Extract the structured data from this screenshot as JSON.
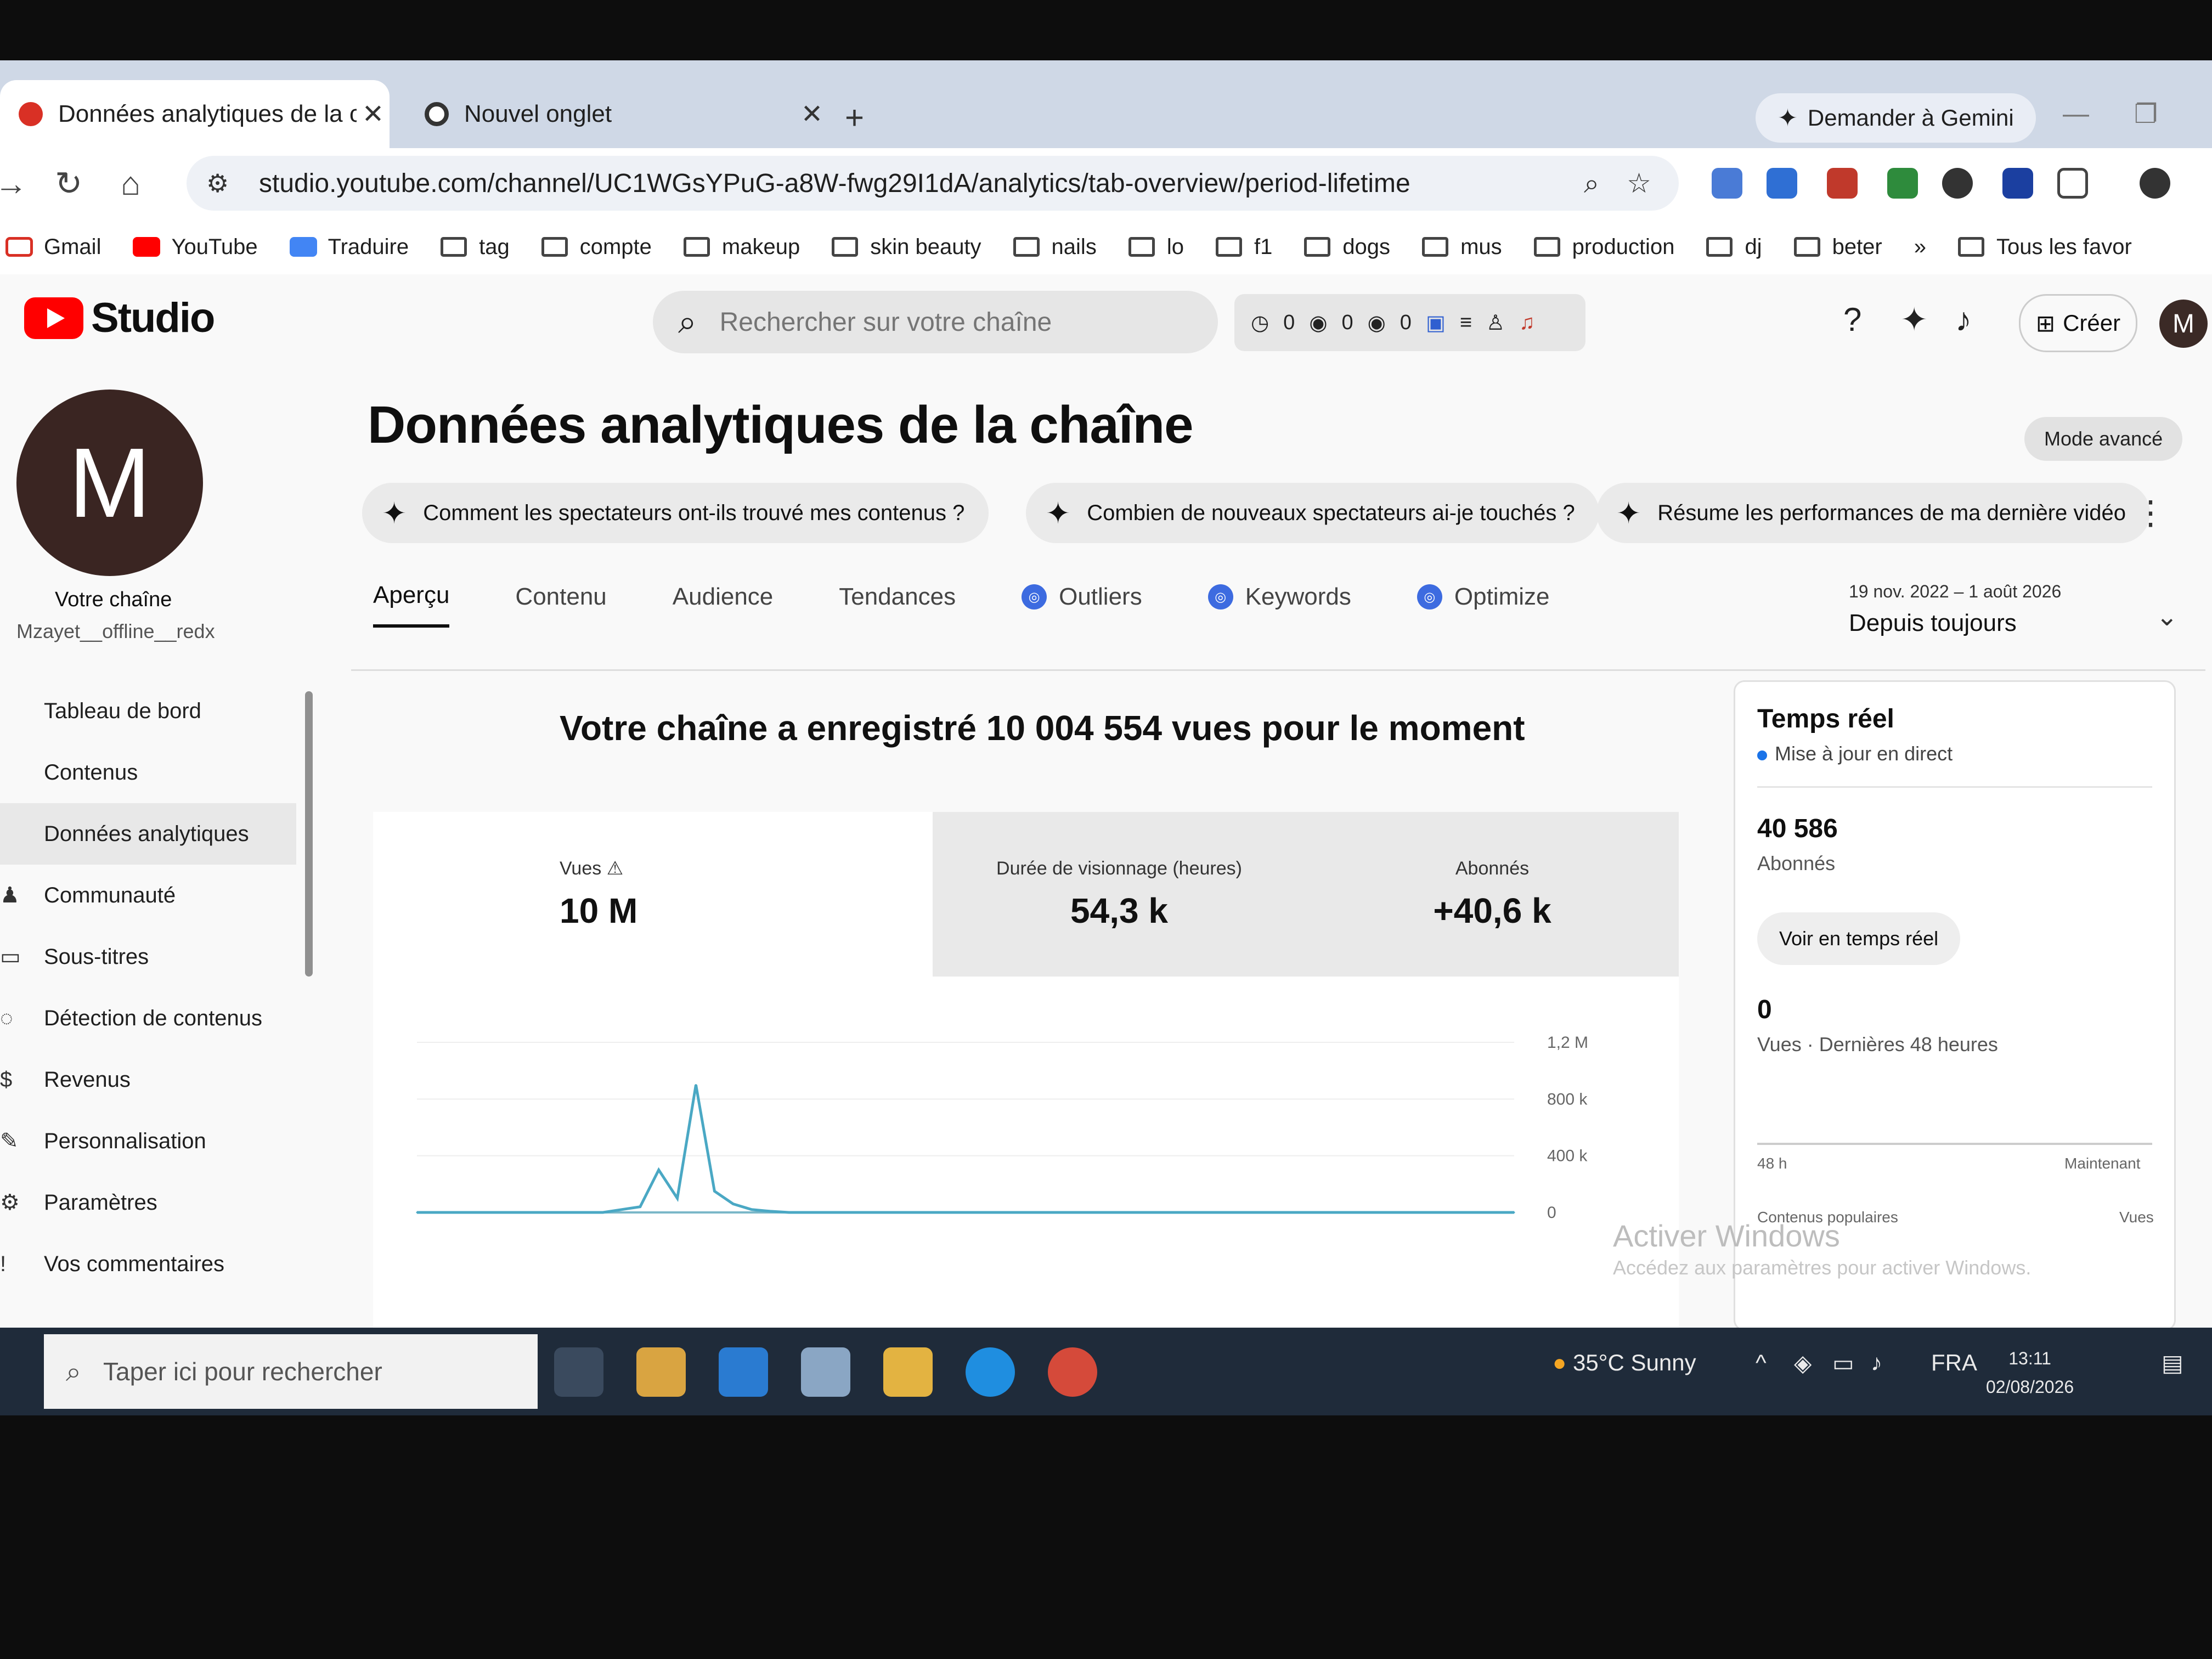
{
  "browser": {
    "tabs": [
      {
        "title": "Données analytiques de la chaî",
        "close": "✕"
      },
      {
        "title": "Nouvel onglet",
        "close": "✕"
      }
    ],
    "new_tab": "+",
    "gemini_button": "Demander à Gemini",
    "url": "studio.youtube.com/channel/UC1WGsYPuG-a8W-fwg29I1dA/analytics/tab-overview/period-lifetime",
    "bookmarks": [
      "Gmail",
      "YouTube",
      "Traduire",
      "tag",
      "compte",
      "makeup",
      "skin beauty",
      "nails",
      "lo",
      "f1",
      "dogs",
      "mus",
      "production",
      "dj",
      "beter"
    ],
    "bookmarks_more": "»",
    "all_bookmarks": "Tous les favor"
  },
  "studio": {
    "logo_text": "Studio",
    "search_placeholder": "Rechercher sur votre chaîne",
    "stats_pill": [
      "0",
      "0",
      "0"
    ],
    "create_label": "Créer",
    "avatar_letter": "M"
  },
  "sidebar": {
    "avatar_letter": "M",
    "channel_label": "Votre chaîne",
    "channel_handle": "Mzayet__offline__redx",
    "items": [
      {
        "label": "Tableau de bord",
        "icon": "dashboard-icon"
      },
      {
        "label": "Contenus",
        "icon": "content-icon"
      },
      {
        "label": "Données analytiques",
        "icon": "analytics-icon"
      },
      {
        "label": "Communauté",
        "icon": "community-icon"
      },
      {
        "label": "Sous-titres",
        "icon": "subtitles-icon"
      },
      {
        "label": "Détection de contenus",
        "icon": "detection-icon"
      },
      {
        "label": "Revenus",
        "icon": "revenue-icon"
      },
      {
        "label": "Personnalisation",
        "icon": "customization-icon"
      },
      {
        "label": "Paramètres",
        "icon": "settings-icon"
      },
      {
        "label": "Vos commentaires",
        "icon": "feedback-icon"
      }
    ]
  },
  "main": {
    "title": "Données analytiques de la chaîne",
    "mode_button": "Mode avancé",
    "chips": [
      "Comment les spectateurs ont-ils trouvé mes contenus ?",
      "Combien de nouveaux spectateurs ai-je touchés ?",
      "Résume les performances de ma dernière vidéo"
    ],
    "tabs": [
      "Aperçu",
      "Contenu",
      "Audience",
      "Tendances",
      "Outliers",
      "Keywords",
      "Optimize"
    ],
    "period_range": "19 nov. 2022 – 1 août 2026",
    "period_label": "Depuis toujours",
    "summary": "Votre chaîne a enregistré 10 004 554 vues pour le moment",
    "metrics": [
      {
        "label": "Vues",
        "value": "10 M"
      },
      {
        "label": "Durée de visionnage (heures)",
        "value": "54,3 k"
      },
      {
        "label": "Abonnés",
        "value": "+40,6 k"
      }
    ]
  },
  "chart_data": {
    "type": "line",
    "y_ticks": [
      "1,2 M",
      "800 k",
      "400 k",
      "0"
    ],
    "ylim": [
      0,
      1200000
    ],
    "series": [
      {
        "values": [
          0,
          0,
          0,
          0,
          0,
          0,
          0,
          0,
          0,
          0,
          0,
          20000,
          40000,
          300000,
          100000,
          900000,
          150000,
          60000,
          20000,
          8000,
          0,
          0,
          0,
          0,
          0,
          0,
          0,
          0,
          0,
          0,
          0,
          0,
          0,
          0,
          0,
          0,
          0,
          0,
          0,
          0,
          0,
          0,
          0,
          0,
          0,
          0,
          0,
          0,
          0,
          0,
          0,
          0,
          0,
          0,
          0,
          0,
          0,
          0,
          0,
          0
        ]
      }
    ]
  },
  "realtime": {
    "title": "Temps réel",
    "live": "Mise à jour en direct",
    "subs_value": "40 586",
    "subs_label": "Abonnés",
    "button": "Voir en temps réel",
    "views_value": "0",
    "views_label": "Vues · Dernières 48 heures",
    "axis_left": "48 h",
    "axis_right": "Maintenant",
    "popular": "Contenus populaires",
    "popular_right": "Vues"
  },
  "watermark": {
    "title": "Activer Windows",
    "sub": "Accédez aux paramètres pour activer Windows."
  },
  "taskbar": {
    "search_placeholder": "Taper ici pour rechercher",
    "weather": "35°C  Sunny",
    "lang": "FRA",
    "time": "13:11",
    "date": "02/08/2026"
  }
}
